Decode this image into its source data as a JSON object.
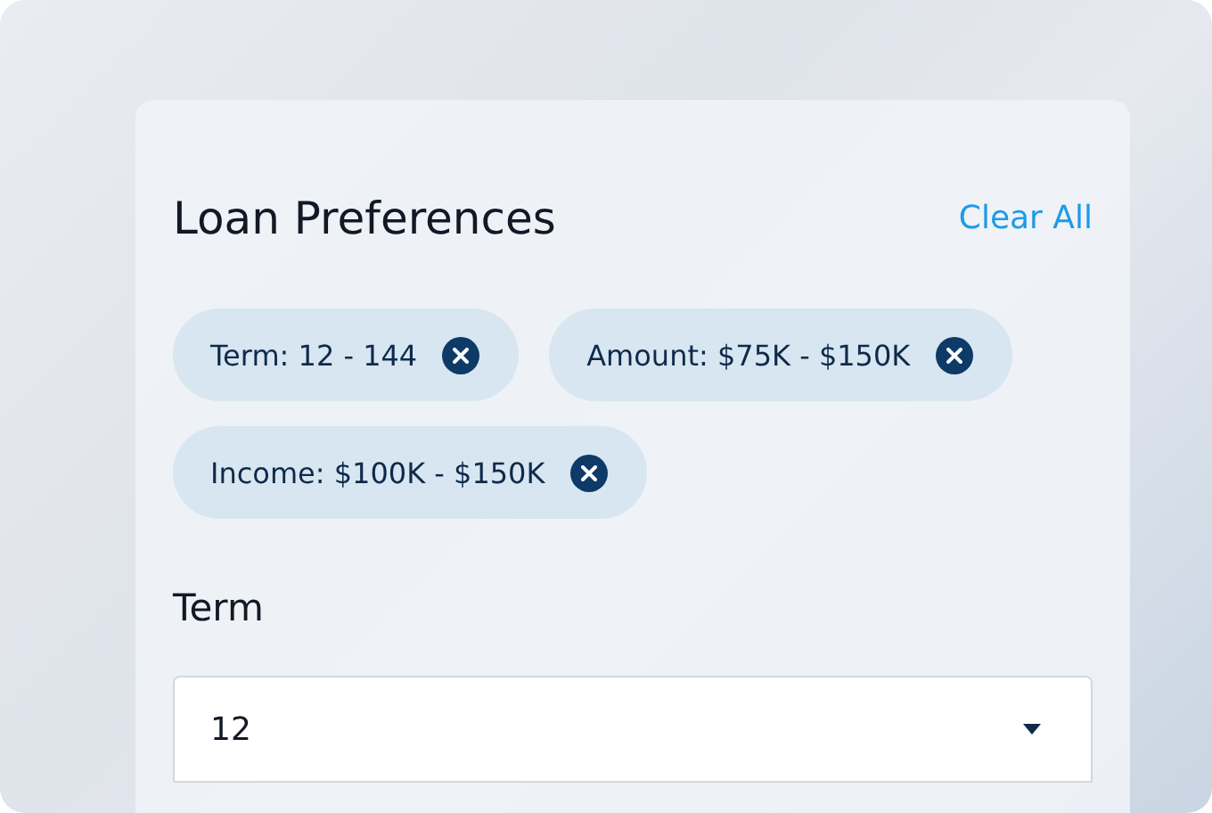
{
  "title": "Loan Preferences",
  "clear_action": "Clear All",
  "chips": [
    {
      "label": "Term: 12 - 144"
    },
    {
      "label": "Amount: $75K - $150K"
    },
    {
      "label": "Income: $100K - $150K"
    }
  ],
  "term": {
    "label": "Term",
    "value": "12"
  }
}
